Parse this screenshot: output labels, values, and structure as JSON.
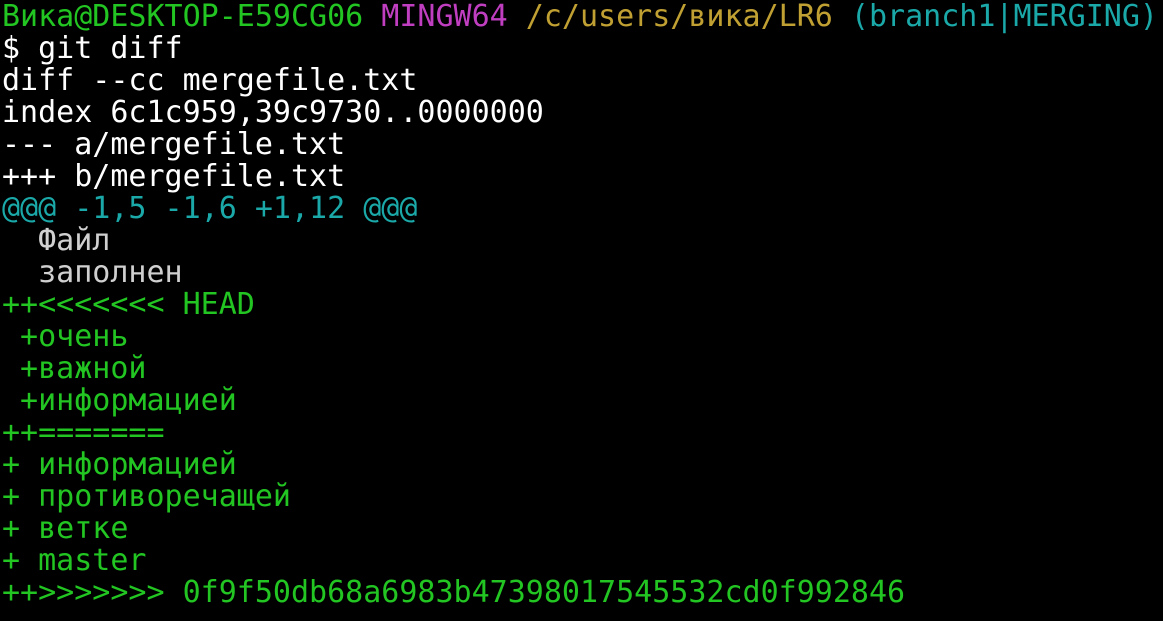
{
  "colors": {
    "background": "#000000",
    "white": "#ffffff",
    "green": "#22c522",
    "magenta": "#c03ec0",
    "yellow": "#c0a032",
    "cyan": "#1ba8a8",
    "grey": "#d0d0d0"
  },
  "terminal": {
    "lines": [
      {
        "name": "prompt-line",
        "segments": [
          {
            "text": "Вика@DESKTOP-E59CG06",
            "color": "green",
            "name": "prompt-user-host"
          },
          {
            "text": " ",
            "color": "white",
            "name": "prompt-space"
          },
          {
            "text": "MINGW64",
            "color": "magenta",
            "name": "prompt-shell"
          },
          {
            "text": " ",
            "color": "white",
            "name": "prompt-space"
          },
          {
            "text": "/c/users/вика/LR6",
            "color": "yellow",
            "name": "prompt-path"
          },
          {
            "text": " ",
            "color": "white",
            "name": "prompt-space"
          },
          {
            "text": "(branch1|MERGING)",
            "color": "cyan",
            "name": "prompt-branch"
          }
        ]
      },
      {
        "name": "command-line",
        "segments": [
          {
            "text": "$ git diff",
            "color": "white",
            "name": "command-text"
          }
        ]
      },
      {
        "name": "diff-header-line",
        "segments": [
          {
            "text": "diff --cc mergefile.txt",
            "color": "white",
            "name": "diff-header"
          }
        ]
      },
      {
        "name": "index-line",
        "segments": [
          {
            "text": "index 6c1c959,39c9730..0000000",
            "color": "white",
            "name": "diff-index"
          }
        ]
      },
      {
        "name": "old-file-line",
        "segments": [
          {
            "text": "--- a/mergefile.txt",
            "color": "white",
            "name": "diff-old-file"
          }
        ]
      },
      {
        "name": "new-file-line",
        "segments": [
          {
            "text": "+++ b/mergefile.txt",
            "color": "white",
            "name": "diff-new-file"
          }
        ]
      },
      {
        "name": "hunk-header-line",
        "segments": [
          {
            "text": "@@@ -1,5 -1,6 +1,12 @@@",
            "color": "cyan",
            "name": "diff-hunk-header"
          }
        ]
      },
      {
        "name": "context-line",
        "segments": [
          {
            "text": "  Файл",
            "color": "grey",
            "name": "diff-context"
          }
        ]
      },
      {
        "name": "context-line",
        "segments": [
          {
            "text": "  заполнен",
            "color": "grey",
            "name": "diff-context"
          }
        ]
      },
      {
        "name": "added-line",
        "segments": [
          {
            "text": "++<<<<<<< HEAD",
            "color": "green",
            "name": "conflict-marker-start"
          }
        ]
      },
      {
        "name": "added-line",
        "segments": [
          {
            "text": " +очень",
            "color": "green",
            "name": "diff-added"
          }
        ]
      },
      {
        "name": "added-line",
        "segments": [
          {
            "text": " +важной",
            "color": "green",
            "name": "diff-added"
          }
        ]
      },
      {
        "name": "added-line",
        "segments": [
          {
            "text": " +информацией",
            "color": "green",
            "name": "diff-added"
          }
        ]
      },
      {
        "name": "added-line",
        "segments": [
          {
            "text": "++=======",
            "color": "green",
            "name": "conflict-marker-separator"
          }
        ]
      },
      {
        "name": "added-line",
        "segments": [
          {
            "text": "+ информацией",
            "color": "green",
            "name": "diff-added"
          }
        ]
      },
      {
        "name": "added-line",
        "segments": [
          {
            "text": "+ противоречащей",
            "color": "green",
            "name": "diff-added"
          }
        ]
      },
      {
        "name": "added-line",
        "segments": [
          {
            "text": "+ ветке",
            "color": "green",
            "name": "diff-added"
          }
        ]
      },
      {
        "name": "added-line",
        "segments": [
          {
            "text": "+ master",
            "color": "green",
            "name": "diff-added"
          }
        ]
      },
      {
        "name": "added-line",
        "segments": [
          {
            "text": "++>>>>>>> 0f9f50db68a6983b47398017545532cd0f992846",
            "color": "green",
            "name": "conflict-marker-end"
          }
        ]
      }
    ]
  }
}
